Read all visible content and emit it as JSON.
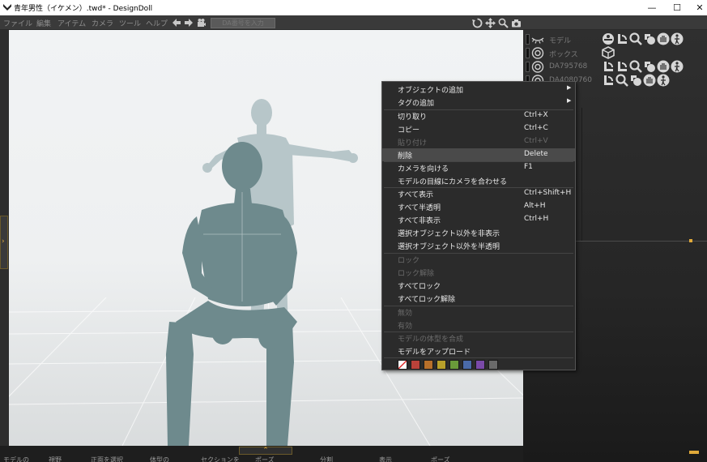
{
  "window": {
    "title": "青年男性（イケメン）.twd* - DesignDoll",
    "min_glyph": "—",
    "max_glyph": "☐",
    "close_glyph": "✕"
  },
  "menubar": {
    "items": [
      "ファイル",
      "編集",
      "アイテム",
      "カメラ",
      "ツール",
      "ヘルプ"
    ],
    "da_input_placeholder": "DA番号を入力"
  },
  "right_panel": {
    "rows": [
      {
        "label": "モデル"
      },
      {
        "label": "ボックス"
      },
      {
        "label": "DA795768"
      },
      {
        "label": "DA4080760"
      }
    ]
  },
  "context_menu": {
    "items": [
      {
        "label": "オブジェクトの追加",
        "shortcut": "",
        "submenu": true,
        "disabled": false
      },
      {
        "label": "タグの追加",
        "shortcut": "",
        "submenu": true,
        "disabled": false
      },
      {
        "label": "切り取り",
        "shortcut": "Ctrl+X",
        "submenu": false,
        "disabled": false
      },
      {
        "label": "コピー",
        "shortcut": "Ctrl+C",
        "submenu": false,
        "disabled": false
      },
      {
        "label": "貼り付け",
        "shortcut": "Ctrl+V",
        "submenu": false,
        "disabled": true
      },
      {
        "label": "削除",
        "shortcut": "Delete",
        "submenu": false,
        "disabled": false,
        "hover": true
      },
      {
        "label": "カメラを向ける",
        "shortcut": "F1",
        "submenu": false,
        "disabled": false
      },
      {
        "label": "モデルの目線にカメラを合わせる",
        "shortcut": "",
        "submenu": false,
        "disabled": false
      },
      {
        "label": "すべて表示",
        "shortcut": "Ctrl+Shift+H",
        "submenu": false,
        "disabled": false
      },
      {
        "label": "すべて半透明",
        "shortcut": "Alt+H",
        "submenu": false,
        "disabled": false
      },
      {
        "label": "すべて非表示",
        "shortcut": "Ctrl+H",
        "submenu": false,
        "disabled": false
      },
      {
        "label": "選択オブジェクト以外を非表示",
        "shortcut": "",
        "submenu": false,
        "disabled": false
      },
      {
        "label": "選択オブジェクト以外を半透明",
        "shortcut": "",
        "submenu": false,
        "disabled": false
      },
      {
        "label": "ロック",
        "shortcut": "",
        "submenu": false,
        "disabled": true
      },
      {
        "label": "ロック解除",
        "shortcut": "",
        "submenu": false,
        "disabled": true
      },
      {
        "label": "すべてロック",
        "shortcut": "",
        "submenu": false,
        "disabled": false
      },
      {
        "label": "すべてロック解除",
        "shortcut": "",
        "submenu": false,
        "disabled": false
      },
      {
        "label": "無効",
        "shortcut": "",
        "submenu": false,
        "disabled": true
      },
      {
        "label": "有効",
        "shortcut": "",
        "submenu": false,
        "disabled": true
      },
      {
        "label": "モデルの体型を合成",
        "shortcut": "",
        "submenu": false,
        "disabled": true
      },
      {
        "label": "モデルをアップロード",
        "shortcut": "",
        "submenu": false,
        "disabled": false
      }
    ],
    "swatch_colors": [
      "#ffffff",
      "#b9423a",
      "#b8702a",
      "#b8a02a",
      "#6a9a3a",
      "#4a6aa8",
      "#7a4aa8",
      "#6a6a6a"
    ]
  },
  "bottom_tabs": [
    "モデルの",
    "視野",
    "正面を選択",
    "体型の",
    "セクションを",
    "ポーズ",
    "分割",
    "表示",
    "ポーズ"
  ],
  "colors": {
    "accent": "#e0a93a",
    "menu_bg": "#2b2b2b",
    "panel_bg": "#2f2f2f"
  },
  "icons": {
    "title": "designdoll-app-icon",
    "back": "back-arrow-icon",
    "forward": "forward-arrow-icon",
    "camera_record": "camera-record-icon",
    "rotate": "rotate-icon",
    "move": "move-icon",
    "zoom": "zoom-icon",
    "screenshot": "camera-icon"
  }
}
